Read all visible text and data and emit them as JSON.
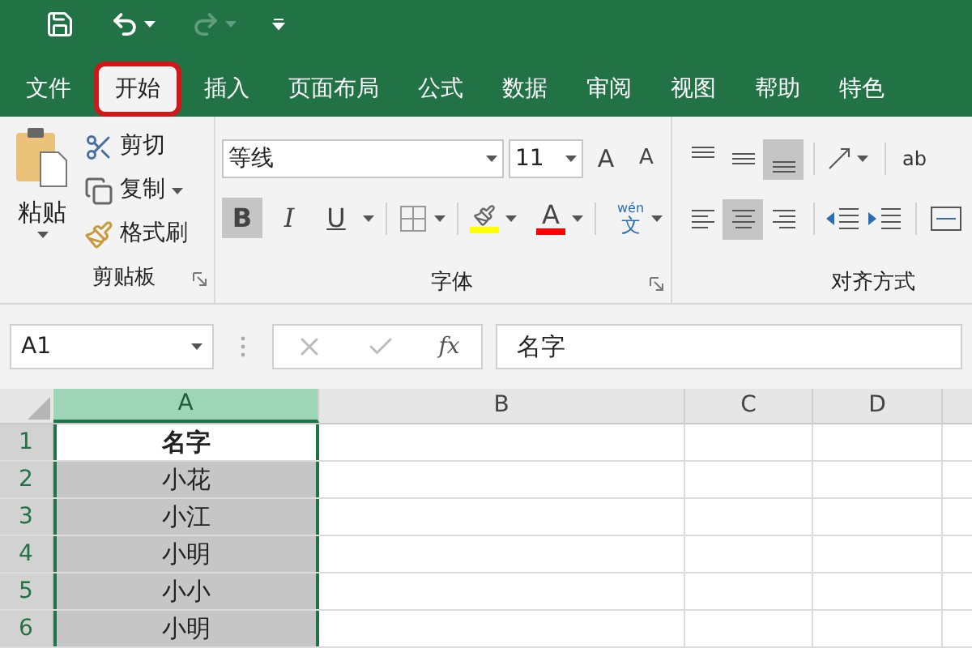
{
  "quick_access": [
    {
      "kind": "save",
      "disabled": false
    },
    {
      "kind": "undo",
      "disabled": false
    },
    {
      "kind": "redo",
      "disabled": true
    },
    {
      "kind": "customize",
      "disabled": false
    }
  ],
  "tabs": [
    {
      "label": "文件",
      "selected": false,
      "highlighted": false
    },
    {
      "label": "开始",
      "selected": true,
      "highlighted": true
    },
    {
      "label": "插入",
      "selected": false,
      "highlighted": false
    },
    {
      "label": "页面布局",
      "selected": false,
      "highlighted": false
    },
    {
      "label": "公式",
      "selected": false,
      "highlighted": false
    },
    {
      "label": "数据",
      "selected": false,
      "highlighted": false
    },
    {
      "label": "审阅",
      "selected": false,
      "highlighted": false
    },
    {
      "label": "视图",
      "selected": false,
      "highlighted": false
    },
    {
      "label": "帮助",
      "selected": false,
      "highlighted": false
    },
    {
      "label": "特色",
      "selected": false,
      "highlighted": false
    }
  ],
  "clipboard": {
    "paste": "粘贴",
    "cut": "剪切",
    "copy": "复制",
    "format_painter": "格式刷",
    "label": "剪贴板"
  },
  "font": {
    "font_name": "等线",
    "font_size": "11",
    "grow_glyph": "A",
    "shrink_glyph": "A",
    "styles": [
      {
        "label": "B",
        "kind": "bold",
        "selected": true
      },
      {
        "label": "I",
        "kind": "italic",
        "selected": false
      },
      {
        "label": "U",
        "kind": "underline",
        "selected": false
      }
    ],
    "font_color_glyph": "A",
    "phonetic_top": "wén",
    "phonetic_char": "文",
    "label": "字体"
  },
  "alignment": {
    "label": "对齐方式",
    "wrap_glyph": "ab",
    "row_1": [
      {
        "kind": "top",
        "selected": false
      },
      {
        "kind": "middle",
        "selected": false
      },
      {
        "kind": "bottom",
        "selected": true
      }
    ],
    "row_2": [
      {
        "kind": "left",
        "selected": false
      },
      {
        "kind": "center",
        "selected": true
      },
      {
        "kind": "right",
        "selected": false
      }
    ]
  },
  "formula_bar": {
    "name_box": "A1",
    "fx": "fx",
    "value": "名字"
  },
  "sheet": {
    "columns": [
      {
        "label": "A",
        "selected": true
      },
      {
        "label": "B",
        "selected": false
      },
      {
        "label": "C",
        "selected": false
      },
      {
        "label": "D",
        "selected": false
      }
    ],
    "rows": [
      {
        "number": "1",
        "cell": "名字",
        "selected": true,
        "active": true
      },
      {
        "number": "2",
        "cell": "小花",
        "selected": true,
        "active": false
      },
      {
        "number": "3",
        "cell": "小江",
        "selected": true,
        "active": false
      },
      {
        "number": "4",
        "cell": "小明",
        "selected": true,
        "active": false
      },
      {
        "number": "5",
        "cell": "小小",
        "selected": true,
        "active": false
      },
      {
        "number": "6",
        "cell": "小明",
        "selected": true,
        "active": false
      }
    ]
  }
}
